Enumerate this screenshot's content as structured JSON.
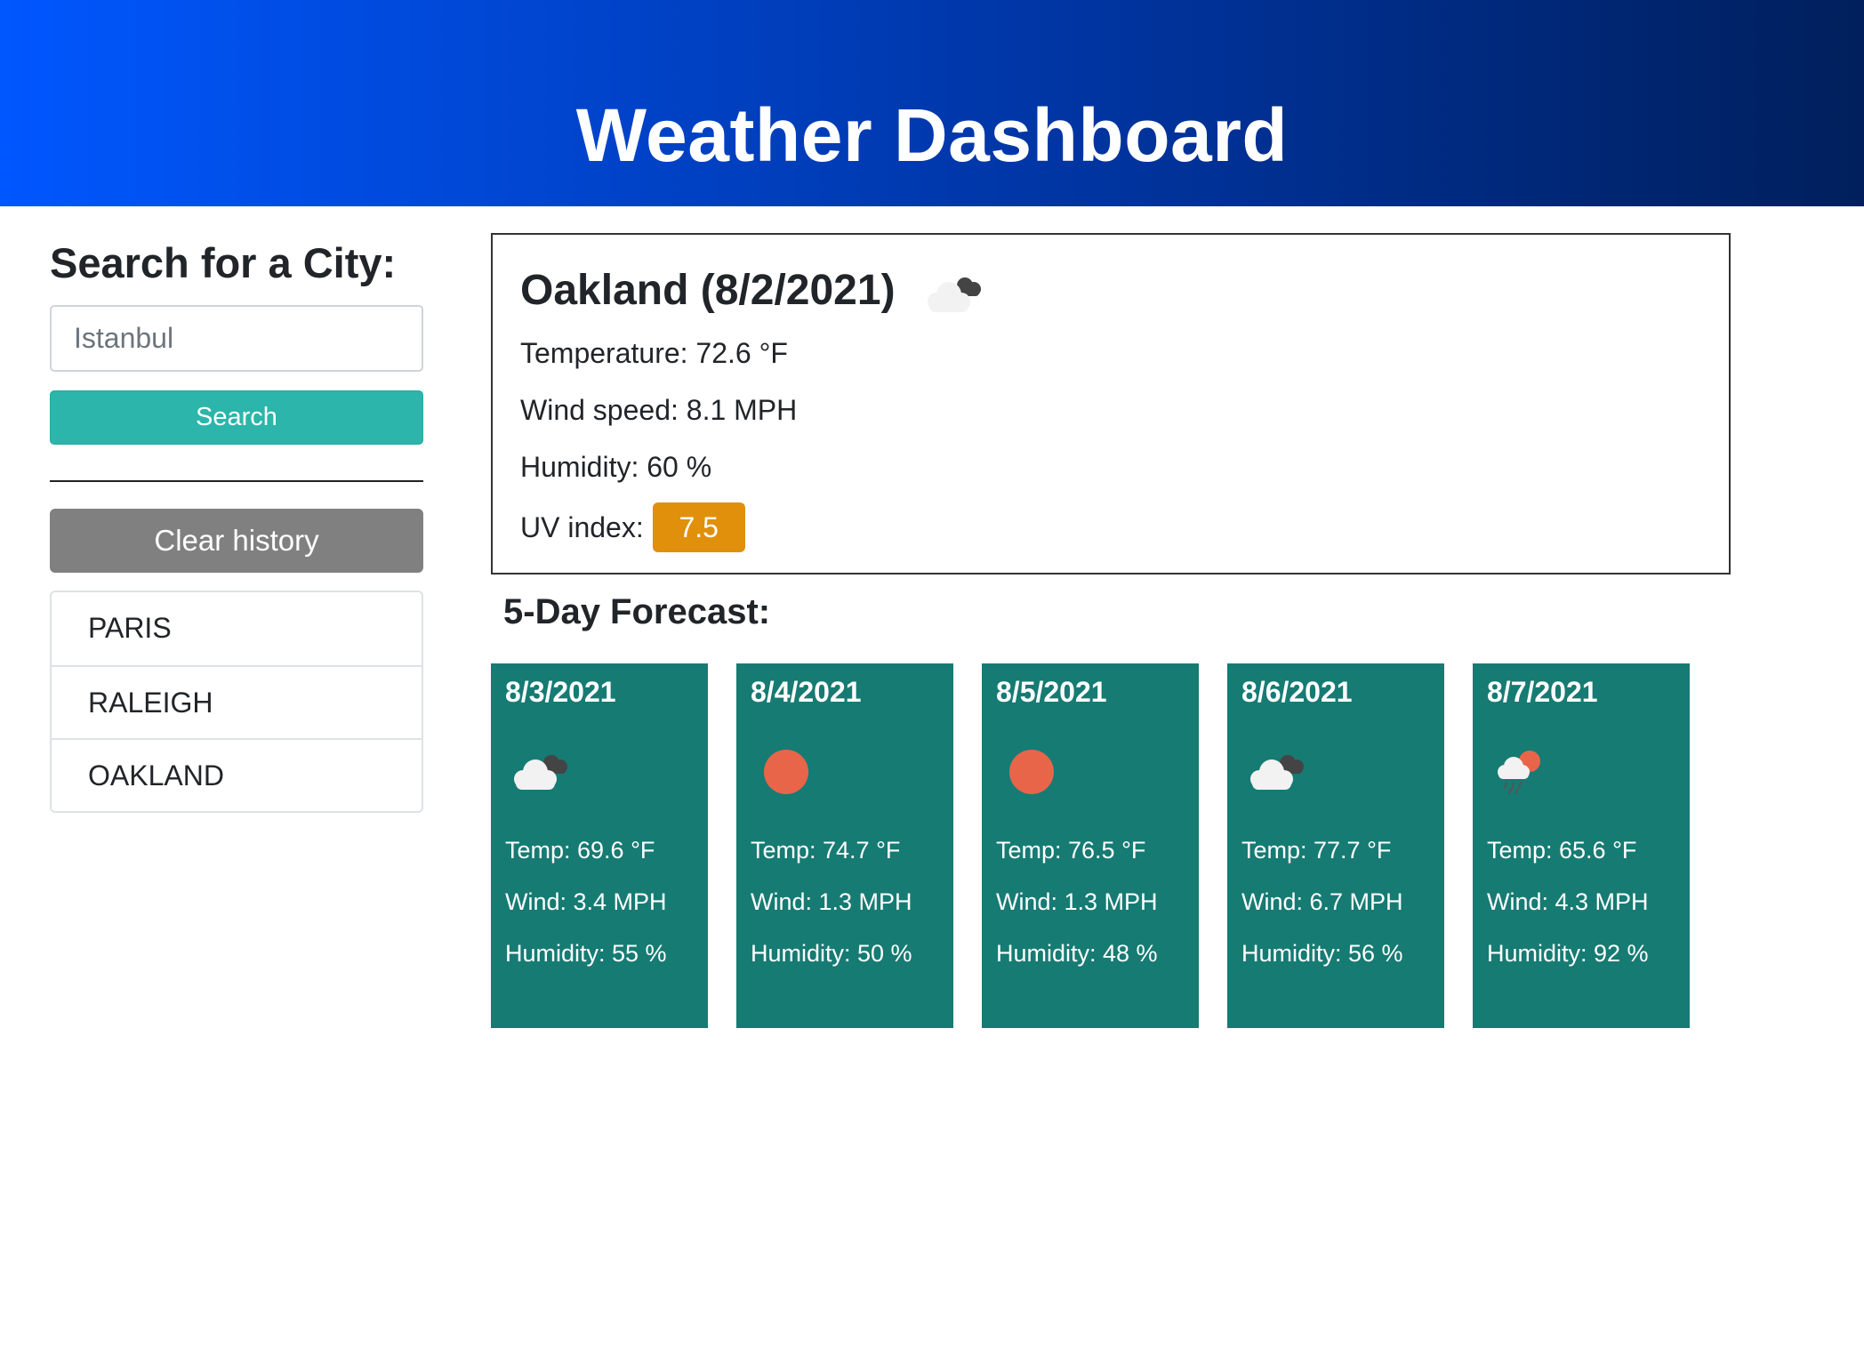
{
  "header": {
    "title": "Weather Dashboard",
    "gradient_colors": [
      "#0057ff",
      "#001f5c"
    ]
  },
  "sidebar": {
    "heading": "Search for a City:",
    "search_input": {
      "value": "",
      "placeholder": "Istanbul"
    },
    "search_button_label": "Search",
    "clear_button_label": "Clear history",
    "history": [
      {
        "label": "PARIS"
      },
      {
        "label": "RALEIGH"
      },
      {
        "label": "OAKLAND"
      }
    ]
  },
  "current": {
    "title": "Oakland (8/2/2021)",
    "icon": "partly-cloudy-icon",
    "temperature": "Temperature: 72.6 °F",
    "wind": "Wind speed: 8.1 MPH",
    "humidity": "Humidity: 60 %",
    "uv_label": "UV index:",
    "uv_value": "7.5",
    "uv_color": "#e0900a"
  },
  "forecast": {
    "title": "5-Day Forecast:",
    "card_color": "#167b73",
    "days": [
      {
        "date": "8/3/2021",
        "icon": "partly-cloudy-icon",
        "temp": "Temp: 69.6 °F",
        "wind": "Wind: 3.4 MPH",
        "humidity": "Humidity: 55 %"
      },
      {
        "date": "8/4/2021",
        "icon": "sun-icon",
        "temp": "Temp: 74.7 °F",
        "wind": "Wind: 1.3 MPH",
        "humidity": "Humidity: 50 %"
      },
      {
        "date": "8/5/2021",
        "icon": "sun-icon",
        "temp": "Temp: 76.5 °F",
        "wind": "Wind: 1.3 MPH",
        "humidity": "Humidity: 48 %"
      },
      {
        "date": "8/6/2021",
        "icon": "partly-cloudy-icon",
        "temp": "Temp: 77.7 °F",
        "wind": "Wind: 6.7 MPH",
        "humidity": "Humidity: 56 %"
      },
      {
        "date": "8/7/2021",
        "icon": "rain-sun-icon",
        "temp": "Temp: 65.6 °F",
        "wind": "Wind: 4.3 MPH",
        "humidity": "Humidity: 92 %"
      }
    ]
  }
}
